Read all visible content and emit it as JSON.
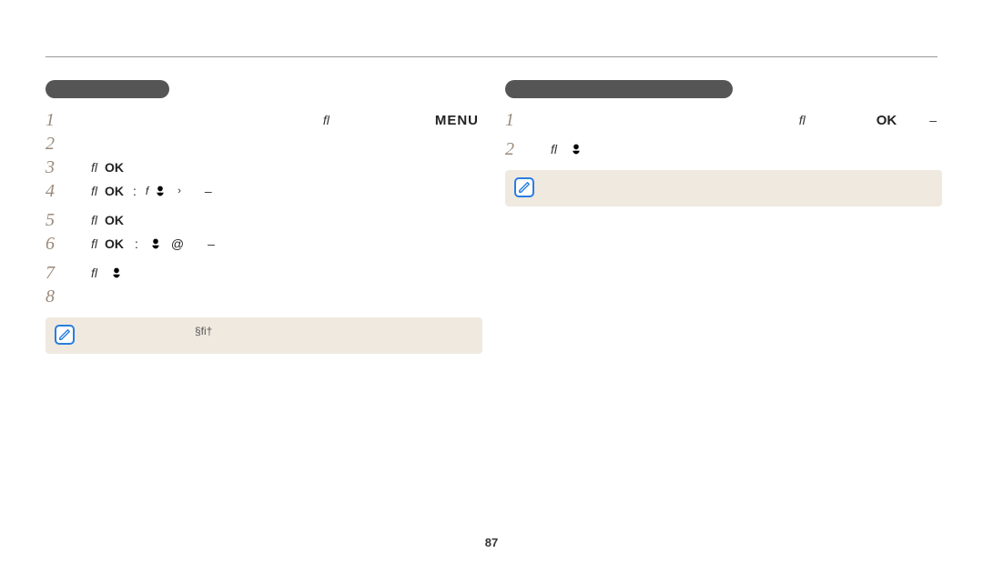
{
  "page_number": "87",
  "labels": {
    "fl": "ﬂ",
    "ok": "OK",
    "menu": "MENU",
    "dash": "–",
    "colon": ":",
    "chevron": "›",
    "at": "@",
    "sfi": "§ﬁ†"
  },
  "left": {
    "pill_width": 136,
    "steps": [
      "1",
      "2",
      "3",
      "4",
      "5",
      "6",
      "7",
      "8"
    ]
  },
  "right": {
    "pill_width": 250,
    "steps": [
      "1",
      "2"
    ]
  }
}
